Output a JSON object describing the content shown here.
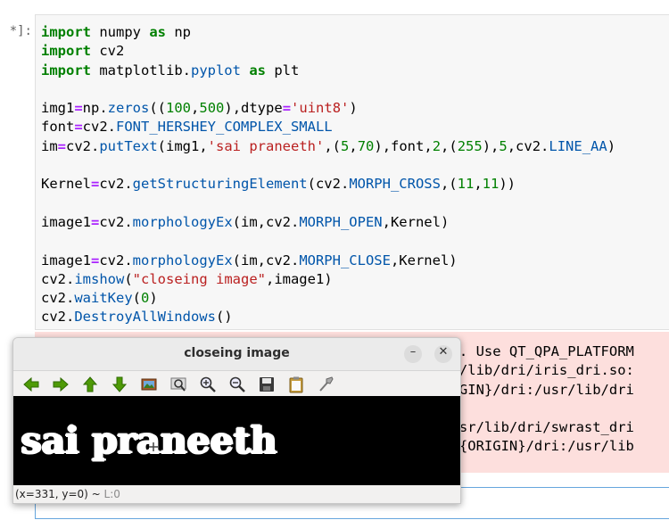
{
  "cell": {
    "prompt": "*]:",
    "code_lines": [
      [
        {
          "t": "import",
          "c": "kw"
        },
        {
          "t": " numpy "
        },
        {
          "t": "as",
          "c": "kw"
        },
        {
          "t": " np"
        }
      ],
      [
        {
          "t": "import",
          "c": "kw"
        },
        {
          "t": " cv2"
        }
      ],
      [
        {
          "t": "import",
          "c": "kw"
        },
        {
          "t": " matplotlib."
        },
        {
          "t": "pyplot",
          "c": "attr"
        },
        {
          "t": " "
        },
        {
          "t": "as",
          "c": "kw"
        },
        {
          "t": " plt"
        }
      ],
      [],
      [
        {
          "t": "img1"
        },
        {
          "t": "=",
          "c": "op"
        },
        {
          "t": "np."
        },
        {
          "t": "zeros",
          "c": "attr"
        },
        {
          "t": "(("
        },
        {
          "t": "100",
          "c": "num"
        },
        {
          "t": ","
        },
        {
          "t": "500",
          "c": "num"
        },
        {
          "t": "),dtype"
        },
        {
          "t": "=",
          "c": "op"
        },
        {
          "t": "'uint8'",
          "c": "str"
        },
        {
          "t": ")"
        }
      ],
      [
        {
          "t": "font"
        },
        {
          "t": "=",
          "c": "op"
        },
        {
          "t": "cv2."
        },
        {
          "t": "FONT_HERSHEY_COMPLEX_SMALL",
          "c": "attr"
        }
      ],
      [
        {
          "t": "im"
        },
        {
          "t": "=",
          "c": "op"
        },
        {
          "t": "cv2."
        },
        {
          "t": "putText",
          "c": "attr"
        },
        {
          "t": "(img1,"
        },
        {
          "t": "'sai praneeth'",
          "c": "str"
        },
        {
          "t": ",("
        },
        {
          "t": "5",
          "c": "num"
        },
        {
          "t": ","
        },
        {
          "t": "70",
          "c": "num"
        },
        {
          "t": "),font,"
        },
        {
          "t": "2",
          "c": "num"
        },
        {
          "t": ",("
        },
        {
          "t": "255",
          "c": "num"
        },
        {
          "t": "),"
        },
        {
          "t": "5",
          "c": "num"
        },
        {
          "t": ",cv2."
        },
        {
          "t": "LINE_AA",
          "c": "attr"
        },
        {
          "t": ")"
        }
      ],
      [],
      [
        {
          "t": "Kernel"
        },
        {
          "t": "=",
          "c": "op"
        },
        {
          "t": "cv2."
        },
        {
          "t": "getStructuringElement",
          "c": "attr"
        },
        {
          "t": "(cv2."
        },
        {
          "t": "MORPH_CROSS",
          "c": "attr"
        },
        {
          "t": ",("
        },
        {
          "t": "11",
          "c": "num"
        },
        {
          "t": ","
        },
        {
          "t": "11",
          "c": "num"
        },
        {
          "t": "))"
        }
      ],
      [],
      [
        {
          "t": "image1"
        },
        {
          "t": "=",
          "c": "op"
        },
        {
          "t": "cv2."
        },
        {
          "t": "morphologyEx",
          "c": "attr"
        },
        {
          "t": "(im,cv2."
        },
        {
          "t": "MORPH_OPEN",
          "c": "attr"
        },
        {
          "t": ",Kernel)"
        }
      ],
      [],
      [
        {
          "t": "image1"
        },
        {
          "t": "=",
          "c": "op"
        },
        {
          "t": "cv2."
        },
        {
          "t": "morphologyEx",
          "c": "attr"
        },
        {
          "t": "(im,cv2."
        },
        {
          "t": "MORPH_CLOSE",
          "c": "attr"
        },
        {
          "t": ",Kernel)"
        }
      ],
      [
        {
          "t": "cv2."
        },
        {
          "t": "imshow",
          "c": "attr"
        },
        {
          "t": "("
        },
        {
          "t": "\"closeing image\"",
          "c": "str"
        },
        {
          "t": ",image1)"
        }
      ],
      [
        {
          "t": "cv2."
        },
        {
          "t": "waitKey",
          "c": "attr"
        },
        {
          "t": "("
        },
        {
          "t": "0",
          "c": "num"
        },
        {
          "t": ")"
        }
      ],
      [
        {
          "t": "cv2."
        },
        {
          "t": "DestroyAllWindows",
          "c": "attr"
        },
        {
          "t": "()"
        }
      ]
    ]
  },
  "stderr": {
    "lines": [
      "                                                ome. Use QT_QPA_PLATFORM",
      "                                                usr/lib/dri/iris_dri.so:",
      "                                                ORIGIN}/dri:/usr/lib/dri",
      "",
      "                                                 /usr/lib/dri/swrast_dri",
      "                                                \\$${ORIGIN}/dri:/usr/lib"
    ]
  },
  "next_cell": {
    "prompt": "]:"
  },
  "window": {
    "title": "closeing image",
    "minimize_label": "–",
    "close_label": "✕",
    "image_text": "sai praneeth",
    "status_coords": "(x=331, y=0) ~ ",
    "status_level": "L:0",
    "toolbar_icons": [
      "arrow-left-icon",
      "arrow-right-icon",
      "arrow-up-icon",
      "arrow-down-icon",
      "zoom-in-image-icon",
      "zoom-fit-icon",
      "zoom-in-icon",
      "zoom-out-icon",
      "save-icon",
      "copy-to-clipboard-icon",
      "properties-icon"
    ]
  }
}
